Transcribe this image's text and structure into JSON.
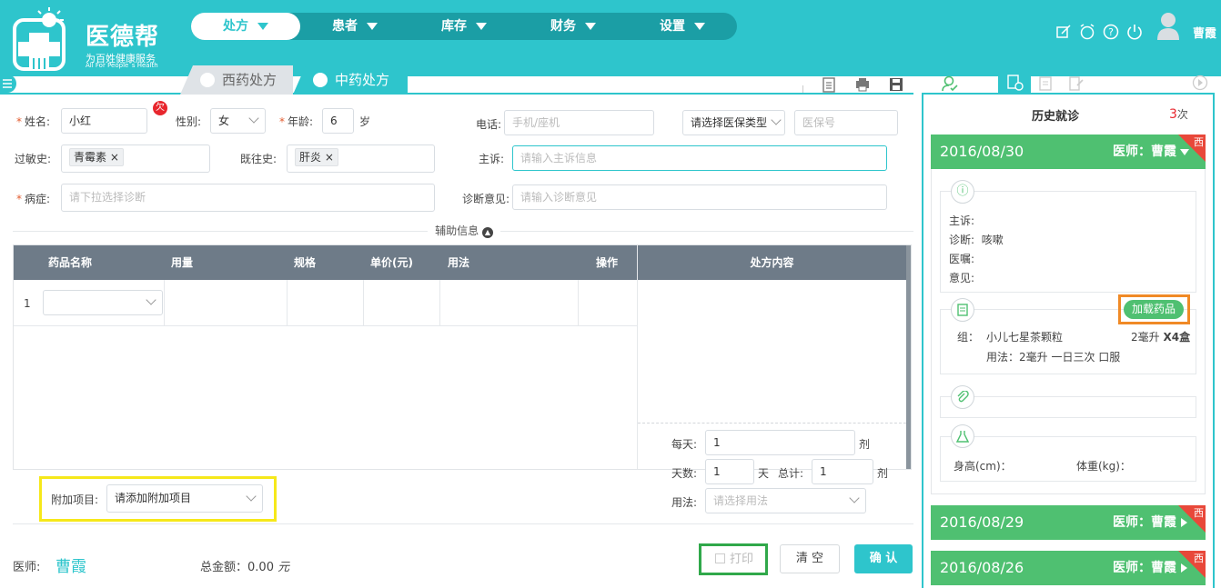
{
  "brand": {
    "name": "医德帮",
    "slogan": "为百姓健康服务",
    "english": "All For People`s Health"
  },
  "nav": [
    {
      "label": "处方",
      "active": true
    },
    {
      "label": "患者"
    },
    {
      "label": "库存"
    },
    {
      "label": "财务"
    },
    {
      "label": "设置"
    }
  ],
  "user": {
    "name": "曹霞"
  },
  "tabs": {
    "western": "西药处方",
    "chinese": "中药处方"
  },
  "form": {
    "name_label": "姓名:",
    "name_value": "小红",
    "owe_badge": "欠",
    "gender_label": "性别:",
    "gender_value": "女",
    "age_label": "年龄:",
    "age_value": "6",
    "age_unit": "岁",
    "phone_label": "电话:",
    "phone_placeholder": "手机/座机",
    "insurance_type_placeholder": "请选择医保类型",
    "insurance_no_placeholder": "医保号",
    "allergy_label": "过敏史:",
    "allergy_tag": "青霉素",
    "history_label": "既往史:",
    "history_tag": "肝炎",
    "complaint_label": "主诉:",
    "complaint_placeholder": "请输入主诉信息",
    "disease_label": "病症:",
    "disease_placeholder": "请下拉选择诊断",
    "opinion_label": "诊断意见:",
    "opinion_placeholder": "请输入诊断意见",
    "aux_info": "辅助信息"
  },
  "table": {
    "columns": [
      "药品名称",
      "用量",
      "规格",
      "单价(元)",
      "用法",
      "操作"
    ],
    "rows": [
      {
        "index": "1"
      }
    ],
    "rx_header": "处方内容"
  },
  "dosage": {
    "per_day_label": "每天:",
    "per_day_value": "1",
    "per_day_unit": "剂",
    "days_label": "天数:",
    "days_value": "1",
    "days_unit": "天",
    "total_label": "总计:",
    "total_value": "1",
    "total_unit": "剂",
    "usage_label": "用法:",
    "usage_placeholder": "请选择用法"
  },
  "extra": {
    "label": "附加项目:",
    "placeholder": "请添加附加项目"
  },
  "footer": {
    "doctor_label": "医师:",
    "doctor_name": "曹霞",
    "total_label": "总金额：",
    "total_value": "0.00",
    "total_unit": "元",
    "print_label": "打印",
    "clear_label": "清 空",
    "confirm_label": "确 认"
  },
  "history": {
    "title": "历史就诊",
    "count": "3",
    "count_unit": "次",
    "visits": [
      {
        "date": "2016/08/30",
        "doctor": "医师：曹霞",
        "badge": "西"
      },
      {
        "date": "2016/08/29",
        "doctor": "医师：曹霞",
        "badge": "西"
      },
      {
        "date": "2016/08/26",
        "doctor": "医师：曹霞",
        "badge": "西"
      }
    ],
    "detail": {
      "complaint": "主诉:",
      "diagnosis_label": "诊断:",
      "diagnosis_value": "咳嗽",
      "advice": "医嘱:",
      "opinion": "意见:",
      "load_button": "加载药品",
      "group_label": "组：",
      "drug_name": "小儿七星茶颗粒",
      "drug_amount": "2毫升",
      "drug_qty": "X4盒",
      "drug_usage": "用法：2毫升   一日三次   口服",
      "height_label": "身高(cm)：",
      "weight_label": "体重(kg)："
    }
  },
  "colors": {
    "accent": "#2ec5cc",
    "green": "#4fc071",
    "header_gray": "#6e7b88",
    "badge_red": "#e8483a"
  }
}
